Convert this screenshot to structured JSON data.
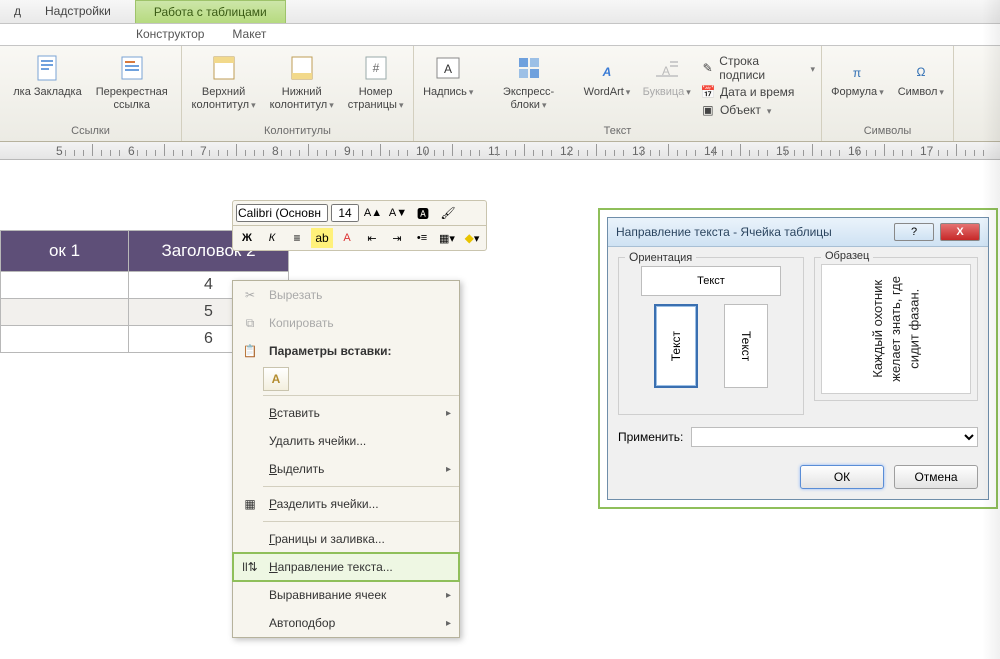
{
  "tabs": {
    "t1": "д",
    "t2": "Надстройки",
    "context_group": "Работа с таблицами",
    "sub1": "Конструктор",
    "sub2": "Макет"
  },
  "ribbon": {
    "links": {
      "label": "Ссылки",
      "bookmark": "лка Закладка",
      "crossref": "Перекрестная\nссылка"
    },
    "headerfooter": {
      "label": "Колонтитулы",
      "top": "Верхний\nколонтитул",
      "bottom": "Нижний\nколонтитул",
      "page": "Номер\nстраницы"
    },
    "text": {
      "label": "Текст",
      "textbox": "Надпись",
      "quick": "Экспресс-блоки",
      "wordart": "WordArt",
      "dropcap": "Буквица",
      "sig": "Строка подписи",
      "date": "Дата и время",
      "obj": "Объект"
    },
    "symbols": {
      "label": "Символы",
      "formula": "Формула",
      "symbol": "Символ"
    }
  },
  "ruler_nums": [
    "5",
    "6",
    "7",
    "8",
    "9",
    "10",
    "11",
    "12",
    "13",
    "14",
    "15",
    "16",
    "17"
  ],
  "table": {
    "h1": "ок 1",
    "h2": "Заголовок 2",
    "rows": [
      [
        "",
        "4"
      ],
      [
        "",
        "5"
      ],
      [
        "",
        "6"
      ]
    ]
  },
  "minibar": {
    "font": "Calibri (Основн",
    "size": "14",
    "bold": "Ж",
    "italic": "К"
  },
  "context_menu": {
    "cut": "Вырезать",
    "copy": "Копировать",
    "paste_hdr": "Параметры вставки:",
    "insert": "Вставить",
    "delcells": "Удалить ячейки...",
    "select": "Выделить",
    "split": "Разделить ячейки...",
    "borders": "Границы и заливка...",
    "textdir": "Направление текста...",
    "align": "Выравнивание ячеек",
    "autofit": "Автоподбор"
  },
  "dialog": {
    "title": "Направление текста - Ячейка таблицы",
    "orient_legend": "Ориентация",
    "sample_legend": "Образец",
    "btn_h": "Текст",
    "btn_v1": "Текст",
    "btn_v2": "Текст",
    "sample_text": "Каждый охотник\nжелает знать, где\nсидит фазан.",
    "apply": "Применить:",
    "ok": "ОК",
    "cancel": "Отмена"
  }
}
